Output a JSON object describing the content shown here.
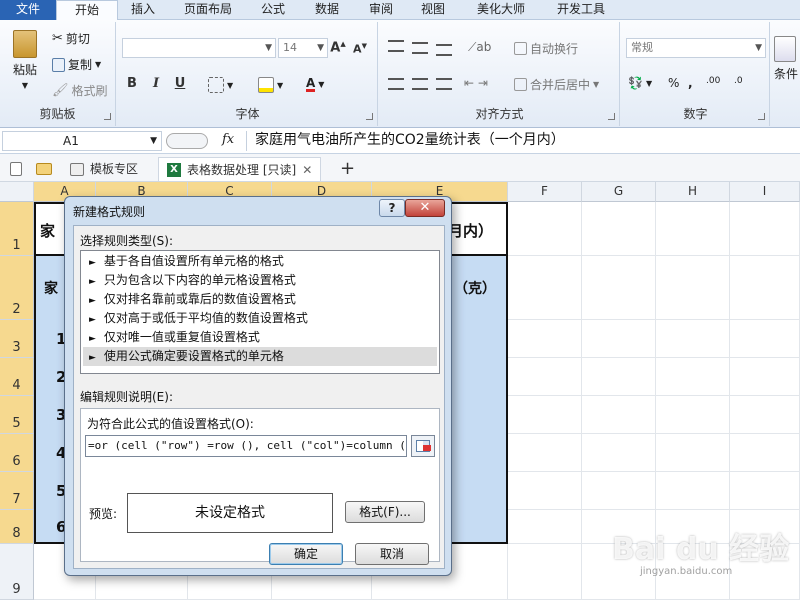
{
  "ribbon_tabs": [
    "文件",
    "开始",
    "插入",
    "页面布局",
    "公式",
    "数据",
    "审阅",
    "视图",
    "美化大师",
    "开发工具"
  ],
  "ribbon": {
    "paste_label": "粘贴",
    "cut_label": "剪切",
    "copy_label": "复制",
    "format_painter_label": "格式刷",
    "clipboard_group": "剪贴板",
    "font_size": "14",
    "grow_font": "A",
    "shrink_font": "A",
    "bold": "B",
    "italic": "I",
    "underline": "U",
    "font_group": "字体",
    "wrap_text_label": "自动换行",
    "merge_center_label": "合并后居中",
    "alignment_group": "对齐方式",
    "number_format": "常规",
    "percent": "%",
    "comma": ",",
    "number_group": "数字",
    "cond_label": "条件"
  },
  "formula_bar": {
    "name_box": "A1",
    "fx": "fx",
    "content": "家庭用气电油所产生的CO2量统计表（一个月内）"
  },
  "doc_tabs": {
    "template_tab": "模板专区",
    "workbook_tab": "表格数据处理 [只读]",
    "add_tab": "+"
  },
  "grid": {
    "columns": [
      "A",
      "B",
      "C",
      "D",
      "E",
      "F",
      "G",
      "H",
      "I"
    ],
    "rows": [
      "1",
      "2",
      "3",
      "4",
      "5",
      "6",
      "7",
      "8",
      "9"
    ],
    "a1_fragment": "家",
    "a2_fragment": "家",
    "e1_fragment": "月内）",
    "e2_fragment": "（克）",
    "a_numbers": [
      "1",
      "2",
      "3",
      "4",
      "5",
      "6"
    ]
  },
  "dialog": {
    "title": "新建格式规则",
    "help": "?",
    "close": "✕",
    "select_rule_type_label": "选择规则类型(S):",
    "rule_types": [
      "基于各自值设置所有单元格的格式",
      "只为包含以下内容的单元格设置格式",
      "仅对排名靠前或靠后的数值设置格式",
      "仅对高于或低于平均值的数值设置格式",
      "仅对唯一值或重复值设置格式",
      "使用公式确定要设置格式的单元格"
    ],
    "selected_rule_index": 5,
    "edit_rule_label": "编辑规则说明(E):",
    "formula_label": "为符合此公式的值设置格式(O):",
    "formula_value": "=or (cell (\"row\") =row (), cell (\"col\")=column ())",
    "preview_label": "预览:",
    "preview_text": "未设定格式",
    "format_button": "格式(F)...",
    "ok_button": "确定",
    "cancel_button": "取消"
  },
  "watermark": {
    "brand": "Bai du 经验",
    "url": "jingyan.baidu.com"
  },
  "colors": {
    "file_tab": "#2a64b4",
    "selection_fill": "#c6dcf3",
    "header_highlight": "#f6d98f",
    "dialog_frame": "#cfdff0",
    "close_button": "#c2433a"
  }
}
